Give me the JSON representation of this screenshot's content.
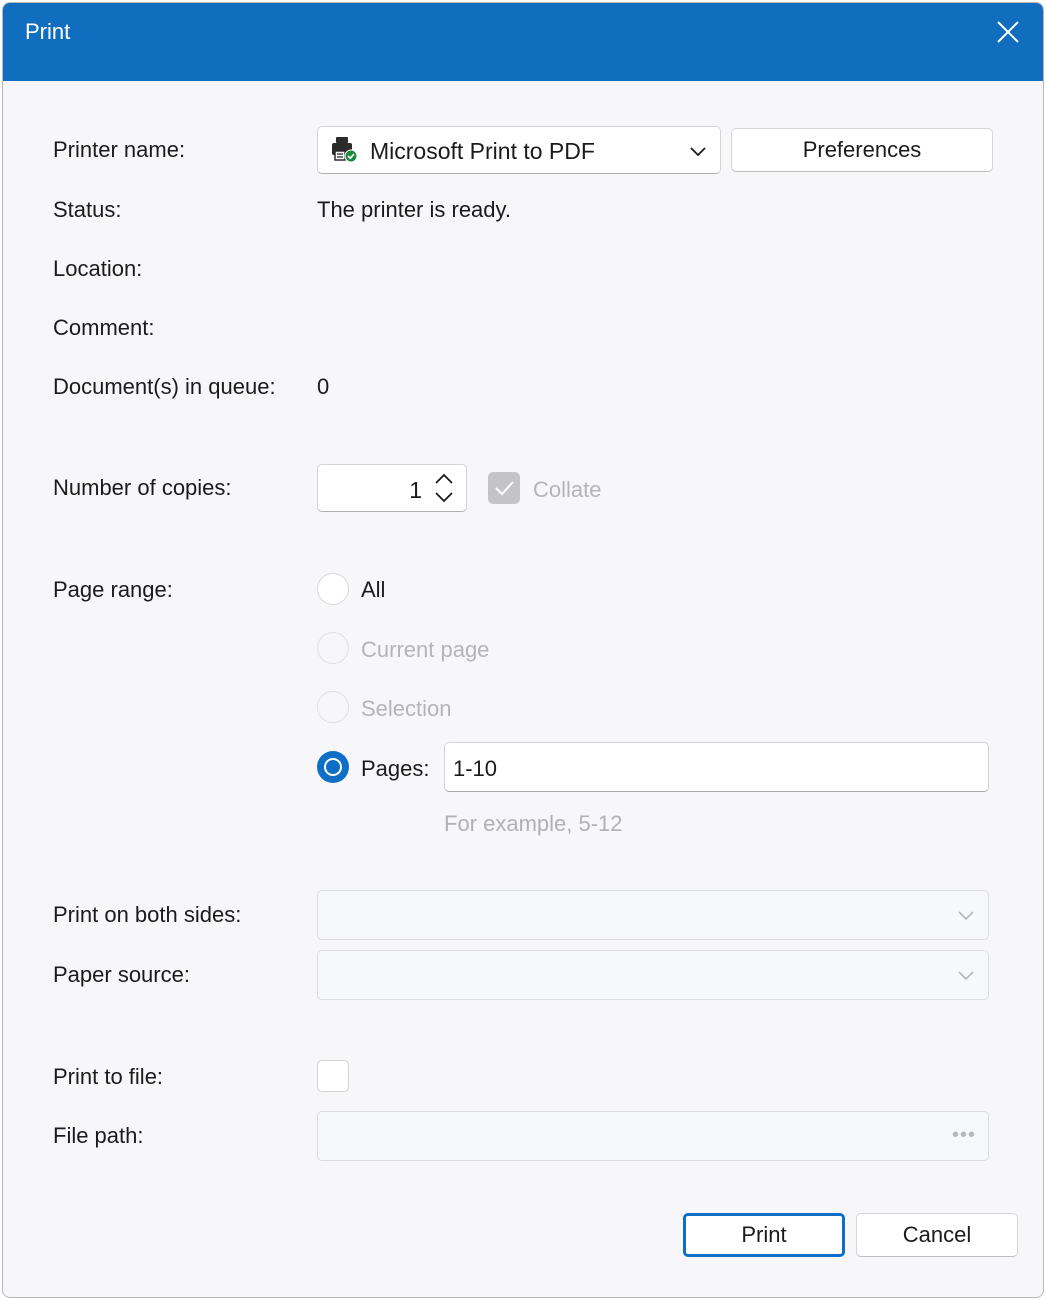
{
  "window": {
    "title": "Print",
    "close_icon": "close-icon"
  },
  "printer": {
    "name_label": "Printer name:",
    "selected_printer": "Microsoft Print to PDF",
    "printer_icon": "printer-ready-icon",
    "preferences_label": "Preferences",
    "status_label": "Status:",
    "status_value": "The printer is ready.",
    "location_label": "Location:",
    "location_value": "",
    "comment_label": "Comment:",
    "comment_value": "",
    "queue_label": "Document(s) in queue:",
    "queue_value": "0"
  },
  "copies": {
    "label": "Number of copies:",
    "value": "1",
    "collate_label": "Collate",
    "collate_checked": true,
    "collate_enabled": false
  },
  "page_range": {
    "label": "Page range:",
    "options": [
      {
        "label": "All",
        "checked": false,
        "enabled": true
      },
      {
        "label": "Current page",
        "checked": false,
        "enabled": false
      },
      {
        "label": "Selection",
        "checked": false,
        "enabled": false
      },
      {
        "label": "Pages:",
        "checked": true,
        "enabled": true
      }
    ],
    "pages_value": "1-10",
    "pages_hint": "For example, 5-12"
  },
  "duplex": {
    "label": "Print on both sides:",
    "value": ""
  },
  "paper_source": {
    "label": "Paper source:",
    "value": ""
  },
  "print_to_file": {
    "label": "Print to file:",
    "checked": false
  },
  "file_path": {
    "label": "File path:",
    "value": "",
    "browse_icon": "more-icon"
  },
  "actions": {
    "print_label": "Print",
    "cancel_label": "Cancel"
  },
  "colors": {
    "titlebar": "#116ebf",
    "accent": "#0f6fc6",
    "background": "#f7f7f9"
  }
}
